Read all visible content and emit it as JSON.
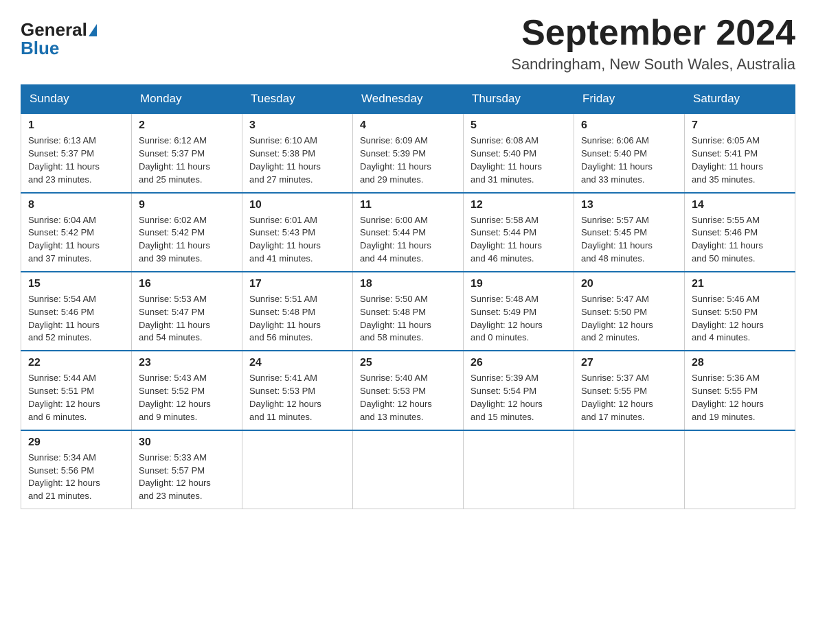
{
  "logo": {
    "general": "General",
    "blue": "Blue"
  },
  "header": {
    "month": "September 2024",
    "location": "Sandringham, New South Wales, Australia"
  },
  "weekdays": [
    "Sunday",
    "Monday",
    "Tuesday",
    "Wednesday",
    "Thursday",
    "Friday",
    "Saturday"
  ],
  "weeks": [
    [
      {
        "day": "1",
        "sunrise": "6:13 AM",
        "sunset": "5:37 PM",
        "daylight": "11 hours and 23 minutes."
      },
      {
        "day": "2",
        "sunrise": "6:12 AM",
        "sunset": "5:37 PM",
        "daylight": "11 hours and 25 minutes."
      },
      {
        "day": "3",
        "sunrise": "6:10 AM",
        "sunset": "5:38 PM",
        "daylight": "11 hours and 27 minutes."
      },
      {
        "day": "4",
        "sunrise": "6:09 AM",
        "sunset": "5:39 PM",
        "daylight": "11 hours and 29 minutes."
      },
      {
        "day": "5",
        "sunrise": "6:08 AM",
        "sunset": "5:40 PM",
        "daylight": "11 hours and 31 minutes."
      },
      {
        "day": "6",
        "sunrise": "6:06 AM",
        "sunset": "5:40 PM",
        "daylight": "11 hours and 33 minutes."
      },
      {
        "day": "7",
        "sunrise": "6:05 AM",
        "sunset": "5:41 PM",
        "daylight": "11 hours and 35 minutes."
      }
    ],
    [
      {
        "day": "8",
        "sunrise": "6:04 AM",
        "sunset": "5:42 PM",
        "daylight": "11 hours and 37 minutes."
      },
      {
        "day": "9",
        "sunrise": "6:02 AM",
        "sunset": "5:42 PM",
        "daylight": "11 hours and 39 minutes."
      },
      {
        "day": "10",
        "sunrise": "6:01 AM",
        "sunset": "5:43 PM",
        "daylight": "11 hours and 41 minutes."
      },
      {
        "day": "11",
        "sunrise": "6:00 AM",
        "sunset": "5:44 PM",
        "daylight": "11 hours and 44 minutes."
      },
      {
        "day": "12",
        "sunrise": "5:58 AM",
        "sunset": "5:44 PM",
        "daylight": "11 hours and 46 minutes."
      },
      {
        "day": "13",
        "sunrise": "5:57 AM",
        "sunset": "5:45 PM",
        "daylight": "11 hours and 48 minutes."
      },
      {
        "day": "14",
        "sunrise": "5:55 AM",
        "sunset": "5:46 PM",
        "daylight": "11 hours and 50 minutes."
      }
    ],
    [
      {
        "day": "15",
        "sunrise": "5:54 AM",
        "sunset": "5:46 PM",
        "daylight": "11 hours and 52 minutes."
      },
      {
        "day": "16",
        "sunrise": "5:53 AM",
        "sunset": "5:47 PM",
        "daylight": "11 hours and 54 minutes."
      },
      {
        "day": "17",
        "sunrise": "5:51 AM",
        "sunset": "5:48 PM",
        "daylight": "11 hours and 56 minutes."
      },
      {
        "day": "18",
        "sunrise": "5:50 AM",
        "sunset": "5:48 PM",
        "daylight": "11 hours and 58 minutes."
      },
      {
        "day": "19",
        "sunrise": "5:48 AM",
        "sunset": "5:49 PM",
        "daylight": "12 hours and 0 minutes."
      },
      {
        "day": "20",
        "sunrise": "5:47 AM",
        "sunset": "5:50 PM",
        "daylight": "12 hours and 2 minutes."
      },
      {
        "day": "21",
        "sunrise": "5:46 AM",
        "sunset": "5:50 PM",
        "daylight": "12 hours and 4 minutes."
      }
    ],
    [
      {
        "day": "22",
        "sunrise": "5:44 AM",
        "sunset": "5:51 PM",
        "daylight": "12 hours and 6 minutes."
      },
      {
        "day": "23",
        "sunrise": "5:43 AM",
        "sunset": "5:52 PM",
        "daylight": "12 hours and 9 minutes."
      },
      {
        "day": "24",
        "sunrise": "5:41 AM",
        "sunset": "5:53 PM",
        "daylight": "12 hours and 11 minutes."
      },
      {
        "day": "25",
        "sunrise": "5:40 AM",
        "sunset": "5:53 PM",
        "daylight": "12 hours and 13 minutes."
      },
      {
        "day": "26",
        "sunrise": "5:39 AM",
        "sunset": "5:54 PM",
        "daylight": "12 hours and 15 minutes."
      },
      {
        "day": "27",
        "sunrise": "5:37 AM",
        "sunset": "5:55 PM",
        "daylight": "12 hours and 17 minutes."
      },
      {
        "day": "28",
        "sunrise": "5:36 AM",
        "sunset": "5:55 PM",
        "daylight": "12 hours and 19 minutes."
      }
    ],
    [
      {
        "day": "29",
        "sunrise": "5:34 AM",
        "sunset": "5:56 PM",
        "daylight": "12 hours and 21 minutes."
      },
      {
        "day": "30",
        "sunrise": "5:33 AM",
        "sunset": "5:57 PM",
        "daylight": "12 hours and 23 minutes."
      },
      null,
      null,
      null,
      null,
      null
    ]
  ],
  "labels": {
    "sunrise": "Sunrise: ",
    "sunset": "Sunset: ",
    "daylight": "Daylight: "
  }
}
